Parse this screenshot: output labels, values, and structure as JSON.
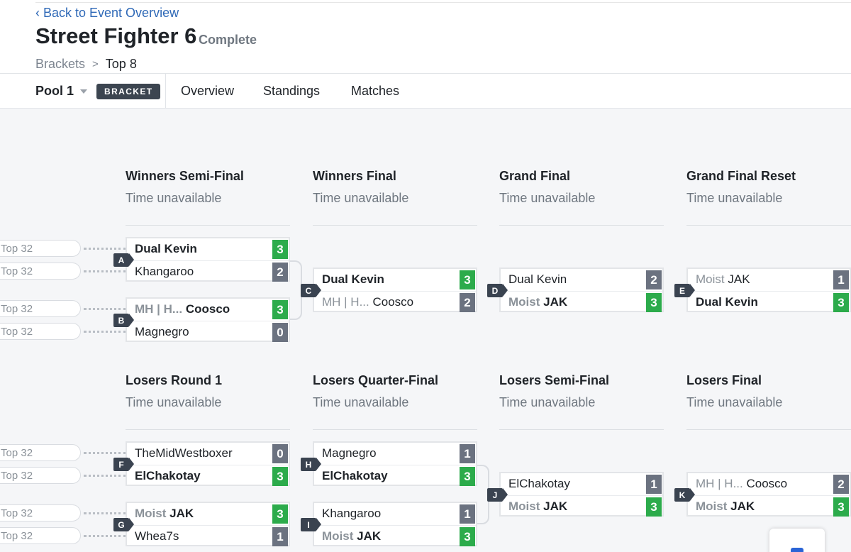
{
  "nav": {
    "back": "Back to Event Overview"
  },
  "header": {
    "title": "Street Fighter 6",
    "status": "Complete"
  },
  "breadcrumb": {
    "items": [
      "Brackets",
      "Top 8"
    ]
  },
  "tabs": {
    "pool": "Pool 1",
    "badge": "BRACKET",
    "items": [
      "Overview",
      "Standings",
      "Matches"
    ]
  },
  "prev_label": "Top 32",
  "rounds": [
    {
      "name": "Winners Semi-Final",
      "time": "Time unavailable"
    },
    {
      "name": "Winners Final",
      "time": "Time unavailable"
    },
    {
      "name": "Grand Final",
      "time": "Time unavailable"
    },
    {
      "name": "Grand Final Reset",
      "time": "Time unavailable"
    },
    {
      "name": "Losers Round 1",
      "time": "Time unavailable"
    },
    {
      "name": "Losers Quarter-Final",
      "time": "Time unavailable"
    },
    {
      "name": "Losers Semi-Final",
      "time": "Time unavailable"
    },
    {
      "name": "Losers Final",
      "time": "Time unavailable"
    }
  ],
  "matches": [
    {
      "id": "A",
      "p": [
        {
          "prefix": "",
          "name": "Dual Kevin",
          "score": "3",
          "win": true
        },
        {
          "prefix": "",
          "name": "Khangaroo",
          "score": "2",
          "win": false
        }
      ]
    },
    {
      "id": "B",
      "p": [
        {
          "prefix": "MH | H...",
          "name": "Coosco",
          "score": "3",
          "win": true
        },
        {
          "prefix": "",
          "name": "Magnegro",
          "score": "0",
          "win": false
        }
      ]
    },
    {
      "id": "C",
      "p": [
        {
          "prefix": "",
          "name": "Dual Kevin",
          "score": "3",
          "win": true
        },
        {
          "prefix": "MH | H...",
          "name": "Coosco",
          "score": "2",
          "win": false
        }
      ]
    },
    {
      "id": "D",
      "p": [
        {
          "prefix": "",
          "name": "Dual Kevin",
          "score": "2",
          "win": false
        },
        {
          "prefix": "Moist",
          "name": "JAK",
          "score": "3",
          "win": true
        }
      ]
    },
    {
      "id": "E",
      "p": [
        {
          "prefix": "Moist",
          "name": "JAK",
          "score": "1",
          "win": false
        },
        {
          "prefix": "",
          "name": "Dual Kevin",
          "score": "3",
          "win": true
        }
      ]
    },
    {
      "id": "F",
      "p": [
        {
          "prefix": "",
          "name": "TheMidWestboxer",
          "score": "0",
          "win": false
        },
        {
          "prefix": "",
          "name": "ElChakotay",
          "score": "3",
          "win": true
        }
      ]
    },
    {
      "id": "G",
      "p": [
        {
          "prefix": "Moist",
          "name": "JAK",
          "score": "3",
          "win": true
        },
        {
          "prefix": "",
          "name": "Whea7s",
          "score": "1",
          "win": false
        }
      ]
    },
    {
      "id": "H",
      "p": [
        {
          "prefix": "",
          "name": "Magnegro",
          "score": "1",
          "win": false
        },
        {
          "prefix": "",
          "name": "ElChakotay",
          "score": "3",
          "win": true
        }
      ]
    },
    {
      "id": "I",
      "p": [
        {
          "prefix": "",
          "name": "Khangaroo",
          "score": "1",
          "win": false
        },
        {
          "prefix": "Moist",
          "name": "JAK",
          "score": "3",
          "win": true
        }
      ]
    },
    {
      "id": "J",
      "p": [
        {
          "prefix": "",
          "name": "ElChakotay",
          "score": "1",
          "win": false
        },
        {
          "prefix": "Moist",
          "name": "JAK",
          "score": "3",
          "win": true
        }
      ]
    },
    {
      "id": "K",
      "p": [
        {
          "prefix": "MH | H...",
          "name": "Coosco",
          "score": "2",
          "win": false
        },
        {
          "prefix": "Moist",
          "name": "JAK",
          "score": "3",
          "win": true
        }
      ]
    }
  ],
  "colors": {
    "win": "#2cab4b",
    "lose": "#6b7280",
    "link": "#2f69b7",
    "label": "#3a4350"
  }
}
